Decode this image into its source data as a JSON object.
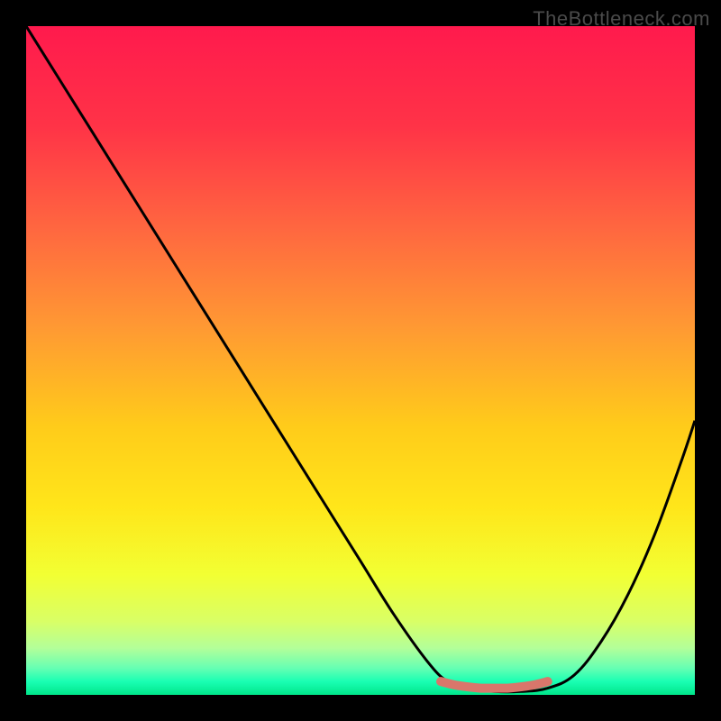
{
  "watermark": "TheBottleneck.com",
  "chart_data": {
    "type": "line",
    "title": "",
    "xlabel": "",
    "ylabel": "",
    "xlim": [
      0,
      100
    ],
    "ylim": [
      0,
      100
    ],
    "series": [
      {
        "name": "bottleneck-curve",
        "x": [
          0,
          5,
          10,
          15,
          20,
          25,
          30,
          35,
          40,
          45,
          50,
          55,
          60,
          63,
          66,
          70,
          74,
          78,
          82,
          86,
          90,
          94,
          98,
          100
        ],
        "y": [
          100,
          92,
          84,
          76,
          68,
          60,
          52,
          44,
          36,
          28,
          20,
          12,
          5,
          2,
          1,
          0.5,
          0.5,
          1,
          3,
          8,
          15,
          24,
          35,
          41
        ]
      },
      {
        "name": "optimal-range-marker",
        "x": [
          62,
          64,
          66,
          68,
          70,
          72,
          74,
          76,
          78
        ],
        "y": [
          2,
          1.5,
          1.2,
          1,
          1,
          1,
          1.2,
          1.5,
          2
        ]
      }
    ],
    "gradient_stops": [
      {
        "pos": 0,
        "color": "#ff1a4d"
      },
      {
        "pos": 15,
        "color": "#ff3347"
      },
      {
        "pos": 30,
        "color": "#ff6640"
      },
      {
        "pos": 45,
        "color": "#ff9933"
      },
      {
        "pos": 60,
        "color": "#ffcc1a"
      },
      {
        "pos": 72,
        "color": "#ffe61a"
      },
      {
        "pos": 82,
        "color": "#f2ff33"
      },
      {
        "pos": 89,
        "color": "#d9ff66"
      },
      {
        "pos": 93,
        "color": "#b3ff99"
      },
      {
        "pos": 96,
        "color": "#66ffb3"
      },
      {
        "pos": 98,
        "color": "#1affb3"
      },
      {
        "pos": 100,
        "color": "#00e68a"
      }
    ],
    "marker_color": "#d9766b"
  }
}
